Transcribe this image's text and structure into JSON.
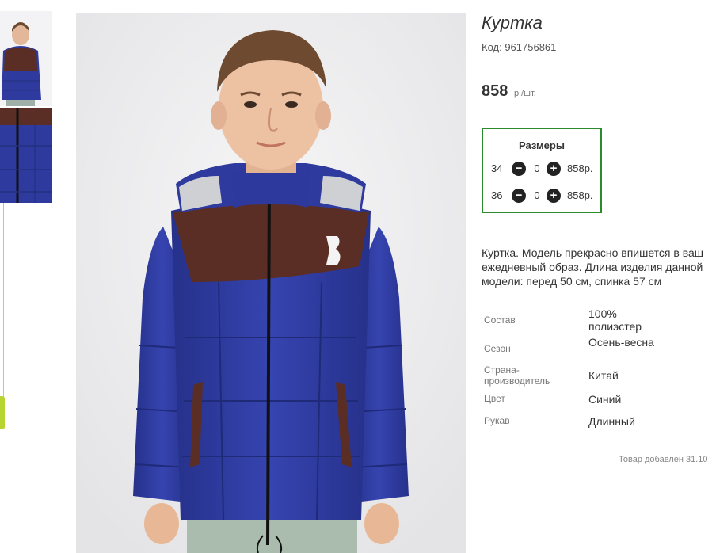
{
  "product": {
    "title": "Куртка",
    "code": "Код: 961756861",
    "price": "858",
    "price_unit": "р./шт."
  },
  "sizes": {
    "title": "Размеры",
    "rows": [
      {
        "size": "34",
        "qty": "0",
        "price": "858р."
      },
      {
        "size": "36",
        "qty": "0",
        "price": "858р."
      }
    ]
  },
  "description": "Куртка. Модель прекрасно впишется в ваш ежедневный образ. Длина изделия данной модели: перед 50 см, спинка 57 см",
  "properties": [
    {
      "key": "Состав",
      "value": "100% полиэстер"
    },
    {
      "key": "Сезон",
      "value": "Осень-весна"
    },
    {
      "key": "Страна-производитель",
      "value": "Китай"
    },
    {
      "key": "Цвет",
      "value": "Синий"
    },
    {
      "key": "Рукав",
      "value": "Длинный"
    }
  ],
  "added": "Товар добавлен 31.10",
  "colors": {
    "accent_border": "#2b8a2b",
    "jacket_blue": "#2f3a9e",
    "jacket_brown": "#5a2e24",
    "rail_green": "#b8d430"
  },
  "icons": {
    "minus": "minus-circle-icon",
    "plus": "plus-circle-icon"
  }
}
